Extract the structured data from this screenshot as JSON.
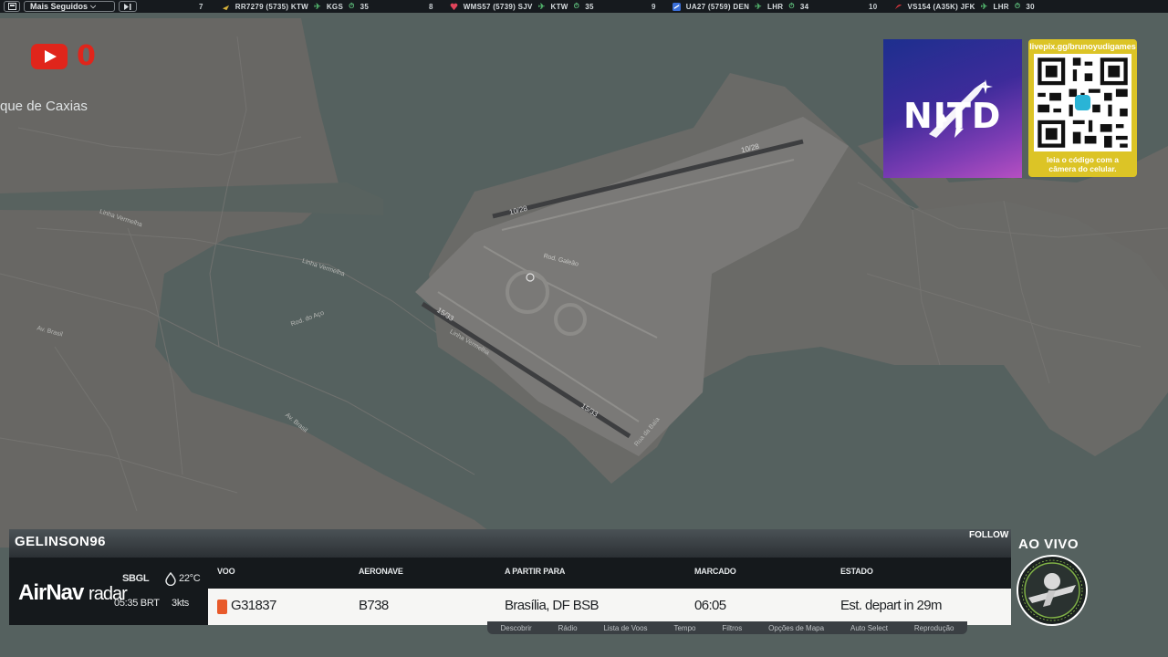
{
  "topbar": {
    "dropdown_label": "Mais Seguidos",
    "flights": [
      {
        "rank": "7",
        "text": "RR7279 (5735) KTW",
        "dest": "KGS",
        "mins": "35",
        "icon_color": "#d7b23a"
      },
      {
        "rank": "8",
        "text": "WMS57 (5739) SJV",
        "dest": "KTW",
        "mins": "35",
        "icon_color": "#e0445a"
      },
      {
        "rank": "9",
        "text": "UA27 (5759) DEN",
        "dest": "LHR",
        "mins": "34",
        "icon_color": "#3a6fd8"
      },
      {
        "rank": "10",
        "text": "VS154 (A35K) JFK",
        "dest": "LHR",
        "mins": "30",
        "icon_color": "#d8353d"
      }
    ]
  },
  "youtube": {
    "count": "0",
    "icon": "youtube-icon"
  },
  "map": {
    "place_label": "que de Caxias",
    "runway_labels": [
      "10/28",
      "10/28",
      "15/33",
      "15/33"
    ],
    "road_labels": [
      "Linha Vermelha",
      "Linha Vermelha",
      "Linha Vermelha",
      "Av. Brasil",
      "Rod. do Aço",
      "Rod. Galeão",
      "Av. Brasil",
      "Rua da Baía"
    ],
    "water_color": "#56625f",
    "land_color": "#6b6a67"
  },
  "ads": {
    "nitd_logo": "NITD",
    "qr_url": "livepix.gg/brunoyudigames",
    "qr_caption_1": "leia o código com a",
    "qr_caption_2": "câmera do celular."
  },
  "panel": {
    "username": "GELINSON96",
    "follow_label": "FOLLOW",
    "brand_main": "AirNav",
    "brand_sub": "radar",
    "airport": "SBGL",
    "time": "05:35 BRT",
    "temperature": "22°C",
    "wind": "3kts",
    "columns": [
      "VOO",
      "AERONAVE",
      "A PARTIR PARA",
      "MARCADO",
      "ESTADO"
    ],
    "row": {
      "flight": "G31837",
      "aircraft": "B738",
      "route": "Brasília, DF BSB",
      "scheduled": "06:05",
      "status": "Est. depart in 29m"
    },
    "menu": [
      "Descobrir",
      "Rádio",
      "Lista de Voos",
      "Tempo",
      "Filtros",
      "Opções de Mapa",
      "Auto Select",
      "Reprodução"
    ],
    "live_label": "AO VIVO"
  },
  "colors": {
    "youtube_red": "#e0251b",
    "accent_green": "#5bb878",
    "qr_gold": "#dcc426",
    "flight_badge": "#e85a2a"
  }
}
